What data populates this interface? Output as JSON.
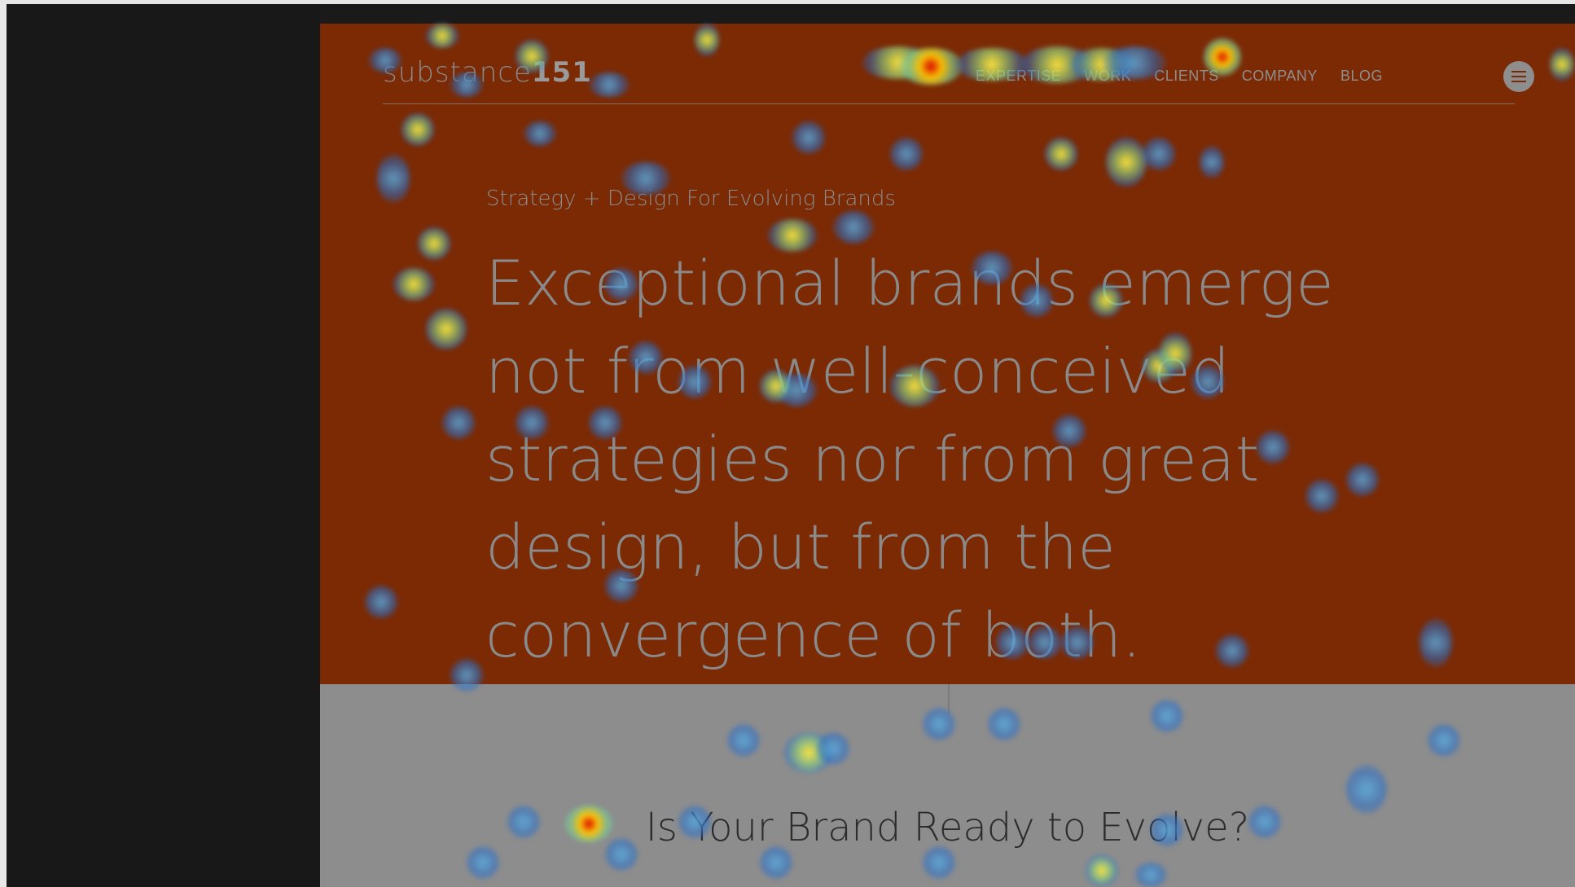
{
  "site": {
    "logo_text": "substance",
    "logo_number": "151",
    "nav": {
      "items": [
        "Expertise",
        "Work",
        "Clients",
        "Company",
        "Blog"
      ]
    },
    "hero": {
      "tagline": "Strategy + Design For Evolving Brands",
      "headline": "Exceptional brands emerge not from well-conceived strategies nor from great design, but from the convergence of both."
    },
    "cta": {
      "heading": "Is Your Brand Ready to Evolve?"
    }
  },
  "colors": {
    "hero_background": "#7b2a04",
    "lower_background": "#8d8d8d",
    "side_panel": "#181818"
  },
  "overlay": {
    "type": "click-heatmap"
  }
}
